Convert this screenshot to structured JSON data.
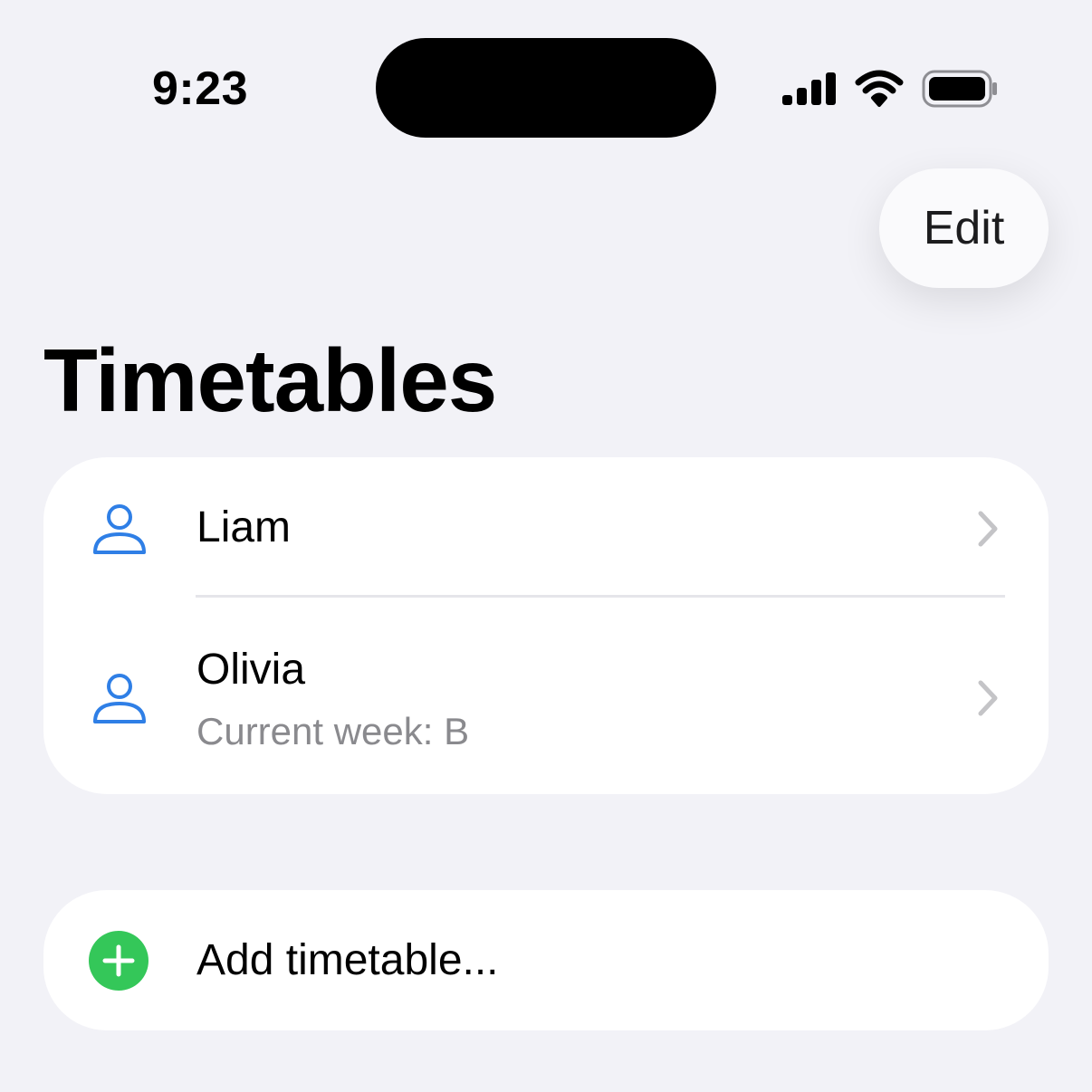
{
  "status_bar": {
    "time": "9:23"
  },
  "nav": {
    "edit_label": "Edit",
    "title": "Timetables"
  },
  "timetables": {
    "items": [
      {
        "name": "Liam",
        "icon": "person-icon"
      },
      {
        "name": "Olivia",
        "subtitle": "Current week: B",
        "icon": "person-icon"
      }
    ]
  },
  "actions": {
    "add_label": "Add timetable...",
    "add_icon": "plus-circle-icon"
  },
  "colors": {
    "accent_blue": "#2f7fe6",
    "add_green": "#34c759",
    "chevron_gray": "#c4c4c7",
    "background": "#f2f2f7"
  }
}
